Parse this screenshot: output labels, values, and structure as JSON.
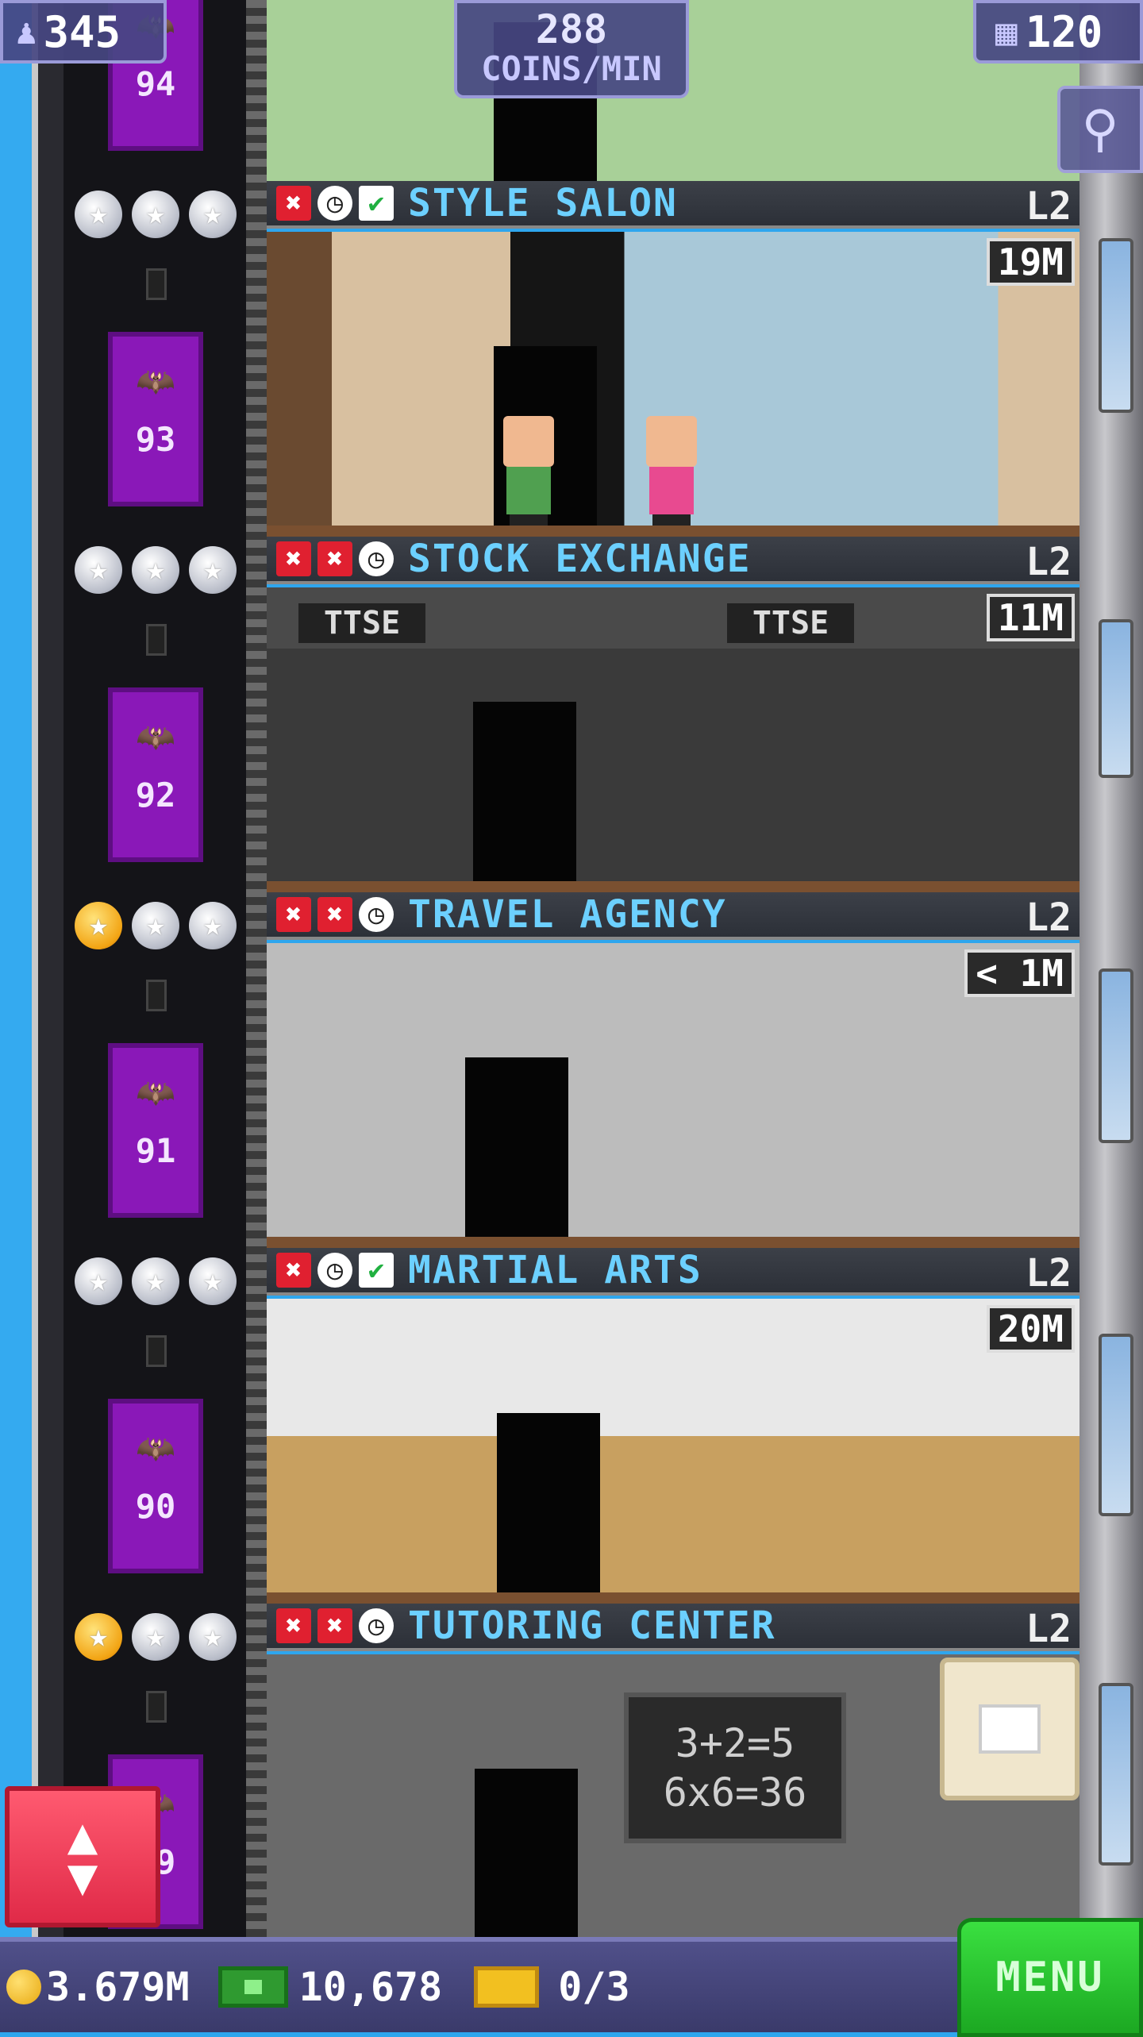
{
  "top": {
    "population": "345",
    "coins_rate_line1": "288",
    "coins_rate_line2": "COINS/MIN",
    "floors": "120"
  },
  "top_floor_number": "94",
  "floors": [
    {
      "number": "93",
      "stars": [
        "silver",
        "silver",
        "silver"
      ],
      "status_icons": [
        "x",
        "clock",
        "check"
      ],
      "name": "STYLE SALON",
      "level": "L2",
      "price": "19M"
    },
    {
      "number": "92",
      "stars": [
        "silver",
        "silver",
        "silver"
      ],
      "status_icons": [
        "x",
        "x",
        "clock"
      ],
      "name": "STOCK EXCHANGE",
      "level": "L2",
      "price": "11M",
      "signs": [
        "TTSE",
        "TTSE"
      ]
    },
    {
      "number": "91",
      "stars": [
        "gold",
        "silver",
        "silver"
      ],
      "status_icons": [
        "x",
        "x",
        "clock"
      ],
      "name": "TRAVEL AGENCY",
      "level": "L2",
      "price": "< 1M"
    },
    {
      "number": "90",
      "stars": [
        "silver",
        "silver",
        "silver"
      ],
      "status_icons": [
        "x",
        "clock",
        "check"
      ],
      "name": "MARTIAL ARTS",
      "level": "L2",
      "price": "20M"
    },
    {
      "number": "89",
      "stars": [
        "gold",
        "silver",
        "silver"
      ],
      "status_icons": [
        "x",
        "x",
        "clock"
      ],
      "name": "TUTORING CENTER",
      "level": "L2",
      "price": "",
      "chalkboard": [
        "3+2=5",
        "6x6=36"
      ]
    }
  ],
  "status": {
    "coins": "3.679M",
    "bux": "10,678",
    "tickets": "0/3",
    "menu": "MENU"
  },
  "colors": {
    "sky": "#34aaf0",
    "room_name": "#6cd0ff",
    "elevator": "#8a18b8",
    "menu_button": "#2fd034",
    "elevator_button": "#f03a58"
  }
}
